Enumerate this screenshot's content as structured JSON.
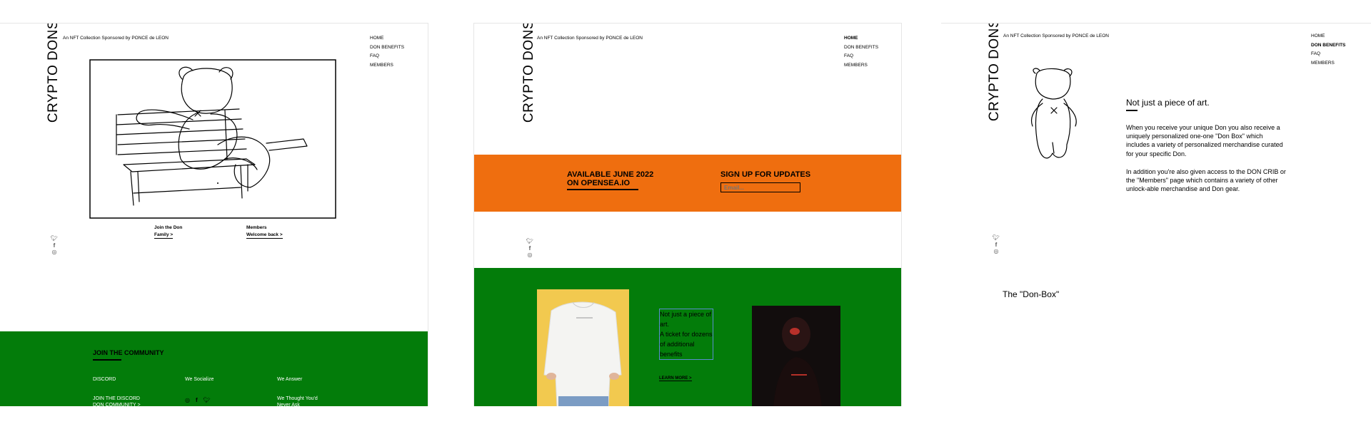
{
  "brand": "CRYPTO DONS",
  "tagline": "An NFT Collection Sponsored by PONCE de LEON",
  "nav": [
    "HOME",
    "DON BENEFITS",
    "FAQ",
    "MEMBERS"
  ],
  "social_icons": [
    "twitter-icon",
    "facebook-icon",
    "instagram-icon"
  ],
  "panel1": {
    "join": {
      "heading": "Join the Don",
      "link": "Family >"
    },
    "members": {
      "heading": "Members",
      "link": "Welcome back >"
    },
    "footer": {
      "title": "JOIN THE COMMUNITY",
      "col1_head": "DISCORD",
      "col1_link": "JOIN THE DISCORD\nDON COMMUNITY >",
      "col2_head": "We Socialize",
      "col3_head": "We Answer",
      "col3_text": "We Thought You'd\nNever Ask"
    },
    "colors": {
      "footer_bg": "#037c0a"
    }
  },
  "panel2": {
    "active_nav": "HOME",
    "banner": {
      "available": "AVAILABLE JUNE 2022\nON OPENSEA.IO",
      "signup_title": "SIGN UP FOR UPDATES",
      "email_placeholder": "Email..."
    },
    "promo": {
      "text": "Not just a piece of art.\nA ticket for dozens of additional benefits",
      "link": "LEARN MORE >"
    },
    "colors": {
      "banner_bg": "#ef6e0f",
      "promo_bg": "#037c0a"
    }
  },
  "panel3": {
    "active_nav": "DON BENEFITS",
    "heading": "Not just a piece of art.",
    "para1": "When you receive your unique Don you also receive a uniquely personalized one-one \"Don Box\" which includes a variety of personalized merchandise curated for your specific Don.",
    "para2": "In addition you're also given access to the DON CRIB or the \"Members\" page which contains a variety of other unlock-able merchandise and Don gear.",
    "donbox_title": "The \"Don-Box\""
  }
}
